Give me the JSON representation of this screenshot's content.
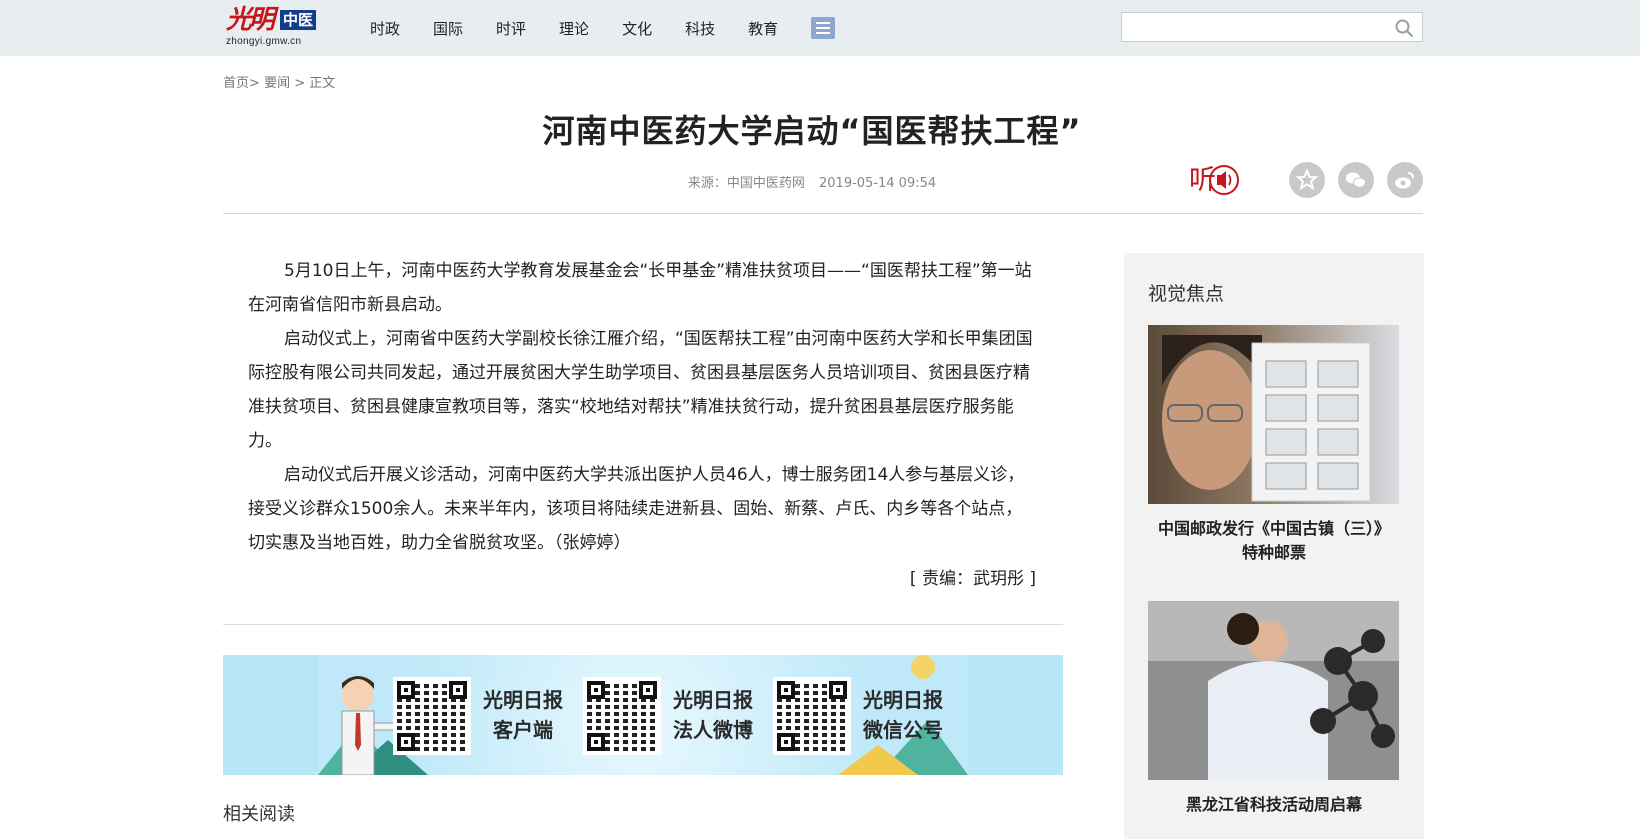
{
  "header": {
    "logo_mark": "光明",
    "logo_badge": "中医",
    "logo_url": "zhongyi.gmw.cn",
    "nav": [
      "时政",
      "国际",
      "时评",
      "理论",
      "文化",
      "科技",
      "教育"
    ],
    "search": {
      "placeholder": "",
      "value": ""
    }
  },
  "breadcrumb": {
    "home": "首页",
    "sep1": ">",
    "section": "要闻",
    "sep2": ">",
    "current": "正文"
  },
  "article": {
    "title": "河南中医药大学启动“国医帮扶工程”",
    "source": "来源：中国中医药网",
    "datetime": "2019-05-14 09:54",
    "listen_label": "听",
    "paragraphs": [
      "5月10日上午，河南中医药大学教育发展基金会“长甲基金”精准扶贫项目——“国医帮扶工程”第一站在河南省信阳市新县启动。",
      "启动仪式上，河南省中医药大学副校长徐江雁介绍，“国医帮扶工程”由河南中医药大学和长甲集团国际控股有限公司共同发起，通过开展贫困大学生助学项目、贫困县基层医务人员培训项目、贫困县医疗精准扶贫项目、贫困县健康宣教项目等，落实“校地结对帮扶”精准扶贫行动，提升贫困县基层医疗服务能力。",
      "启动仪式后开展义诊活动，河南中医药大学共派出医护人员46人，博士服务团14人参与基层义诊，接受义诊群众1500余人。未来半年内，该项目将陆续走进新县、固始、新蔡、卢氏、内乡等各个站点，切实惠及当地百姓，助力全省脱贫攻坚。（张婷婷）"
    ],
    "editor": "[ 责编：武玥彤 ]"
  },
  "banner": {
    "items": [
      {
        "line1": "光明日报",
        "line2": "客户端"
      },
      {
        "line1": "光明日报",
        "line2": "法人微博"
      },
      {
        "line1": "光明日报",
        "line2": "微信公号"
      }
    ]
  },
  "related": {
    "title": "相关阅读"
  },
  "sidebar": {
    "title": "视觉焦点",
    "items": [
      {
        "caption_line1": "中国邮政发行《中国古镇（三）》",
        "caption_line2": "特种邮票"
      },
      {
        "caption_line1": "黑龙江省科技活动周启幕",
        "caption_line2": ""
      }
    ]
  },
  "colors": {
    "topbar": "#e8edf0",
    "brand_red": "#c8161d",
    "brand_blue": "#153c8a",
    "sidebar_bg": "#f2f2f2",
    "banner_bg": "#b9e6f7"
  },
  "icons": [
    "search-icon",
    "menu-icon",
    "listen-icon",
    "favorite-icon",
    "wechat-icon",
    "weibo-icon"
  ]
}
